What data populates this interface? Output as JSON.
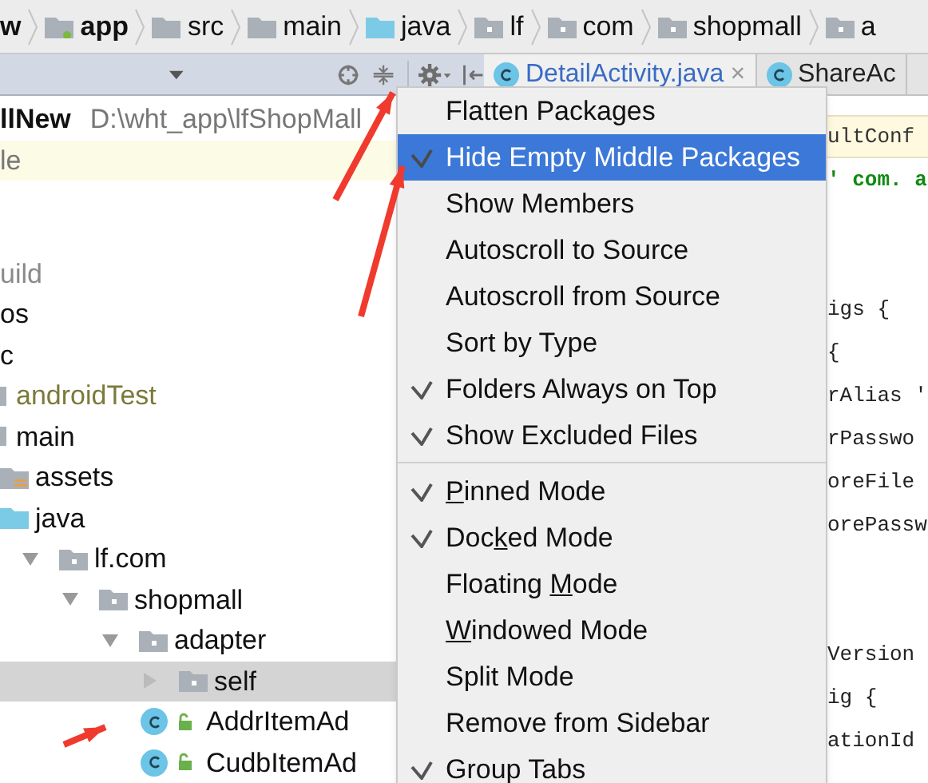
{
  "breadcrumb": [
    {
      "label": "w",
      "kind": "bold"
    },
    {
      "label": "app",
      "kind": "module"
    },
    {
      "label": "src",
      "kind": "folder"
    },
    {
      "label": "main",
      "kind": "folder"
    },
    {
      "label": "java",
      "kind": "source"
    },
    {
      "label": "lf",
      "kind": "package"
    },
    {
      "label": "com",
      "kind": "package"
    },
    {
      "label": "shopmall",
      "kind": "package"
    },
    {
      "label": "a",
      "kind": "package"
    }
  ],
  "tabs": [
    {
      "label": "DetailActivity.java",
      "selected": true,
      "close": "×"
    },
    {
      "label": "ShareAc",
      "selected": false
    }
  ],
  "project_row": {
    "name": "llNew",
    "path": "D:\\wht_app\\lfShopMall"
  },
  "notice_row": {
    "label": "le"
  },
  "tree": [
    {
      "label": "uild",
      "kind": "excluded"
    },
    {
      "label": "os",
      "kind": "plain"
    },
    {
      "label": "c",
      "kind": "plain",
      "children": [
        {
          "label": "androidTest",
          "kind": "test"
        },
        {
          "label": "main",
          "kind": "folder",
          "children": [
            {
              "label": "assets",
              "kind": "assets"
            },
            {
              "label": "java",
              "kind": "source",
              "children": [
                {
                  "label": "lf.com",
                  "kind": "package",
                  "expanded": true,
                  "children": [
                    {
                      "label": "shopmall",
                      "kind": "package",
                      "expanded": true,
                      "children": [
                        {
                          "label": "adapter",
                          "kind": "package",
                          "expanded": true,
                          "children": [
                            {
                              "label": "self",
                              "kind": "package",
                              "expanded": false,
                              "selected": true
                            },
                            {
                              "label": "AddrItemAd",
                              "kind": "class",
                              "selected": false
                            },
                            {
                              "label": "CudbItemAd",
                              "kind": "class",
                              "selected": false
                            }
                          ]
                        }
                      ]
                    }
                  ]
                }
              ]
            }
          ]
        }
      ]
    }
  ],
  "menu": [
    {
      "kind": "item",
      "label": "Flatten Packages",
      "checked": false,
      "selected": false
    },
    {
      "kind": "item",
      "label": "Hide Empty Middle Packages",
      "checked": true,
      "selected": true
    },
    {
      "kind": "item",
      "label": "Show Members",
      "checked": false,
      "selected": false
    },
    {
      "kind": "item",
      "label": "Autoscroll to Source",
      "checked": false,
      "selected": false
    },
    {
      "kind": "item",
      "label": "Autoscroll from Source",
      "checked": false,
      "selected": false
    },
    {
      "kind": "item",
      "label": "Sort by Type",
      "checked": false,
      "selected": false
    },
    {
      "kind": "item",
      "label": "Folders Always on Top",
      "checked": true,
      "selected": false
    },
    {
      "kind": "item",
      "label": "Show Excluded Files",
      "checked": true,
      "selected": false
    },
    {
      "kind": "separator"
    },
    {
      "kind": "item",
      "mnemonic": "P",
      "label_after": "inned Mode",
      "checked": true,
      "selected": false
    },
    {
      "kind": "item",
      "label_before": "Doc",
      "mnemonic": "k",
      "label_after": "ed Mode",
      "checked": true,
      "selected": false
    },
    {
      "kind": "item",
      "label_before": "Floating ",
      "mnemonic": "M",
      "label_after": "ode",
      "checked": false,
      "selected": false
    },
    {
      "kind": "item",
      "mnemonic": "W",
      "label_after": "indowed Mode",
      "checked": false,
      "selected": false
    },
    {
      "kind": "item",
      "label": "Split Mode",
      "checked": false,
      "selected": false
    },
    {
      "kind": "item",
      "label": "Remove from Sidebar",
      "checked": false,
      "selected": false
    },
    {
      "kind": "item",
      "label": "Group Tabs",
      "checked": true,
      "selected": false
    }
  ],
  "code_lines": [
    {
      "text": "ultConf",
      "kind": "highlight"
    },
    {
      "text": "' com. a",
      "kind": "string"
    },
    {
      "kind": "blank"
    },
    {
      "kind": "blank"
    },
    {
      "text": "igs {",
      "kind": "code"
    },
    {
      "text": " {",
      "kind": "code"
    },
    {
      "text": "rAlias '",
      "kind": "code"
    },
    {
      "text": "rPasswo",
      "kind": "code"
    },
    {
      "text": "oreFile",
      "kind": "code"
    },
    {
      "text": "orePassw",
      "kind": "code"
    },
    {
      "kind": "blank"
    },
    {
      "kind": "blank"
    },
    {
      "text": "Version",
      "kind": "code"
    },
    {
      "text": "ig {",
      "kind": "code"
    },
    {
      "text": "ationId",
      "kind": "code"
    }
  ]
}
